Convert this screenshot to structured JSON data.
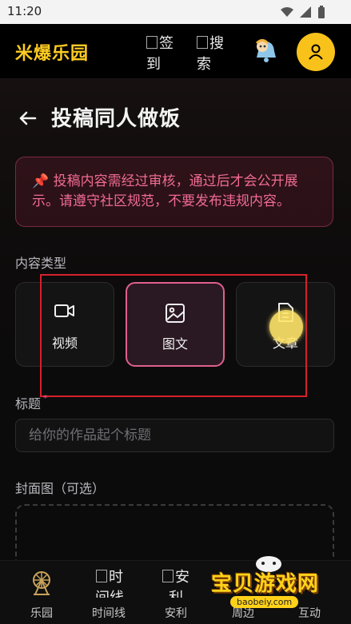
{
  "status_bar": {
    "time": "11:20"
  },
  "header": {
    "brand": "米爆乐园",
    "broken_img_1": "签到",
    "broken_img_2": "搜索"
  },
  "page": {
    "title": "投稿同人做饭",
    "notice": "📌 投稿内容需经过审核，通过后才会公开展示。请遵守社区规范，不要发布违规内容。"
  },
  "content_type": {
    "label": "内容类型",
    "options": [
      {
        "label": "视频",
        "icon": "video-icon",
        "selected": false
      },
      {
        "label": "图文",
        "icon": "image-icon",
        "selected": true
      },
      {
        "label": "文章",
        "icon": "document-icon",
        "selected": false
      }
    ]
  },
  "title_field": {
    "label": "标题",
    "required_mark": "*",
    "placeholder": "给你的作品起个标题"
  },
  "cover": {
    "label": "封面图（可选）"
  },
  "tabbar": {
    "items": [
      {
        "label": "乐园",
        "icon": "ferris-wheel-icon",
        "active": true
      },
      {
        "label": "时间线",
        "broken_img": "时间线"
      },
      {
        "label": "安利",
        "broken_img": "安利"
      },
      {
        "label": "周边"
      },
      {
        "label": "互动"
      }
    ]
  },
  "watermark": {
    "cn": "宝贝游戏网",
    "url": "baobeiy.com"
  },
  "colors": {
    "accent": "#ffcc21",
    "pink": "#e0608f",
    "notice_text": "#f06b93"
  }
}
